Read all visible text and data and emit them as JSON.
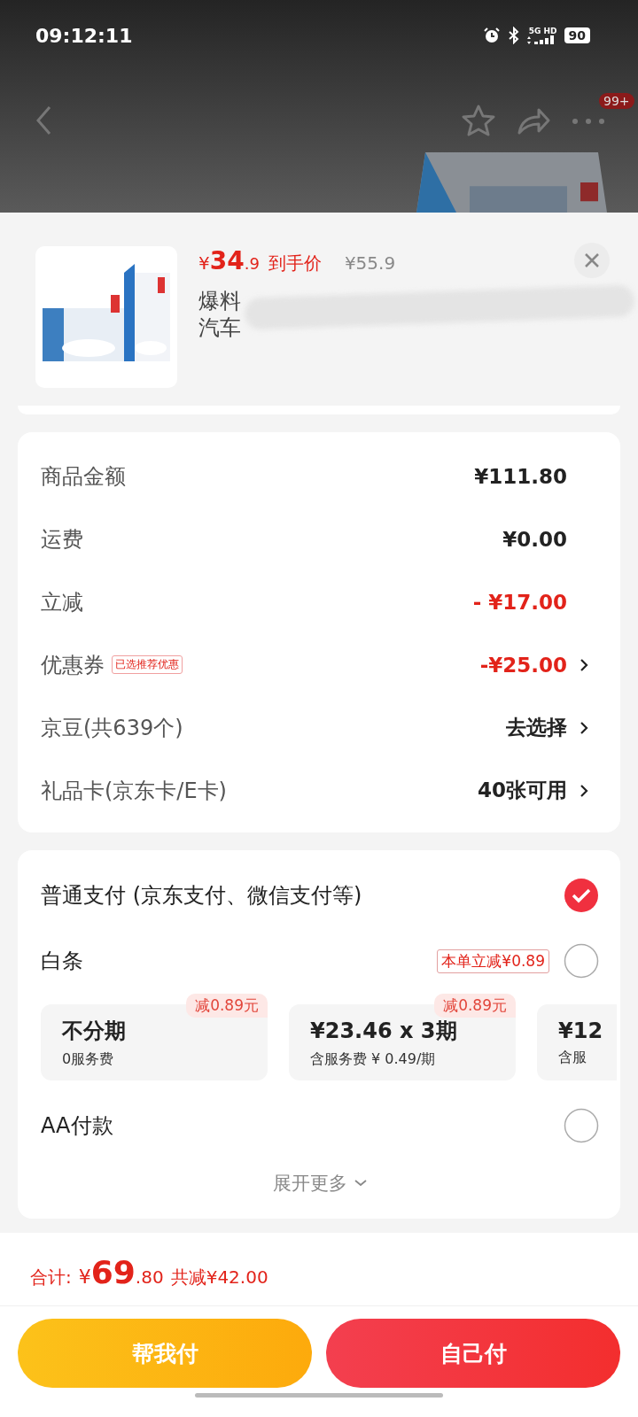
{
  "status_bar": {
    "time": "09:12:11",
    "network": "5G HD",
    "battery": "90"
  },
  "nav": {
    "badge": "99+"
  },
  "product": {
    "currency": "¥",
    "price_int": "34",
    "price_dec": ".9",
    "price_label": "到手价",
    "original_price": "¥55.9",
    "title_lines": [
      "爆料",
      "汽车"
    ]
  },
  "summary": [
    {
      "label": "商品金额",
      "value": "¥111.80",
      "kind": "plain",
      "arrow": false
    },
    {
      "label": "运费",
      "value": "¥0.00",
      "kind": "plain",
      "arrow": false
    },
    {
      "label": "立减",
      "value": "- ¥17.00",
      "kind": "discount",
      "arrow": false
    },
    {
      "label": "优惠券",
      "badge": "已选推荐优惠",
      "value": "-¥25.00",
      "kind": "discount",
      "arrow": true
    },
    {
      "label": "京豆(共639个)",
      "value": "去选择",
      "kind": "plain",
      "arrow": true
    },
    {
      "label": "礼品卡(京东卡/E卡)",
      "value": "40张可用",
      "kind": "plain",
      "arrow": true
    }
  ],
  "payment": {
    "options": [
      {
        "label": "普通支付 (京东支付、微信支付等)",
        "selected": true
      },
      {
        "label": "白条",
        "tag": "本单立减¥0.89",
        "selected": false,
        "installments": [
          {
            "title": "不分期",
            "subtitle": "0服务费",
            "tag": "减0.89元"
          },
          {
            "title": "¥23.46 x 3期",
            "subtitle": "含服务费 ¥ 0.49/期",
            "tag": "减0.89元"
          },
          {
            "title": "¥12",
            "subtitle": "含服"
          }
        ]
      },
      {
        "label": "AA付款",
        "selected": false
      }
    ],
    "expand": "展开更多"
  },
  "footer": {
    "total_label": "合计:",
    "currency": "¥",
    "total_int": "69",
    "total_dec": ".80",
    "saved": "共减¥42.00"
  },
  "buttons": [
    {
      "label": "帮我付",
      "kind": "secondary"
    },
    {
      "label": "自己付",
      "kind": "primary"
    }
  ]
}
